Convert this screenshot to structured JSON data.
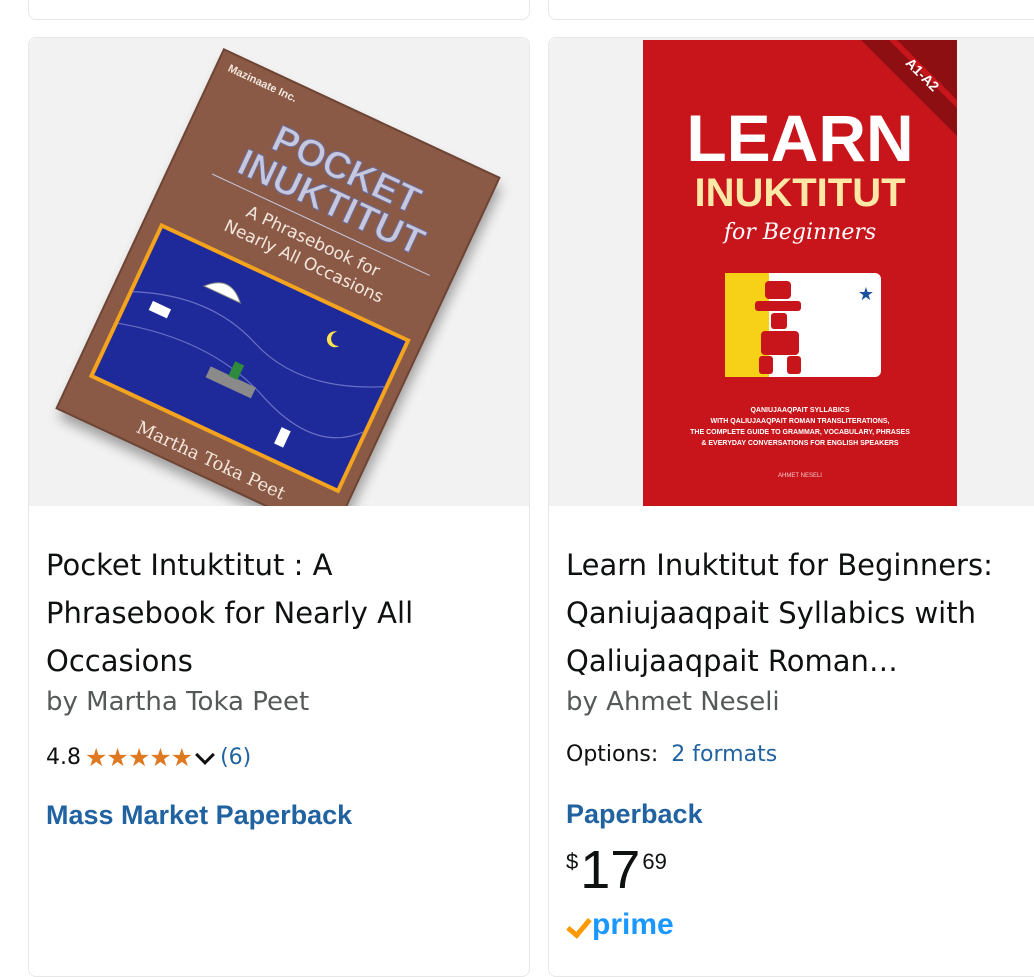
{
  "products": [
    {
      "cover": {
        "publisher": "Mazinaate Inc.",
        "title_line1": "POCKET",
        "title_line2": "INUKTITUT",
        "subtitle_line1": "A Phrasebook for",
        "subtitle_line2": "Nearly All Occasions",
        "author": "Martha Toka Peet"
      },
      "title_line1": "Pocket Intuktitut : A",
      "title_line2": "Phrasebook for Nearly All",
      "title_line3": "Occasions",
      "author": "by Martha Toka Peet",
      "rating": "4.8",
      "rating_stars": 4.8,
      "review_count": "(6)",
      "format": "Mass Market Paperback"
    },
    {
      "cover": {
        "level_badge": "A1-A2",
        "title_line1": "LEARN",
        "title_line2": "INUKTITUT",
        "title_line3": "for Beginners",
        "desc_line1": "QANIUJAAQPAIT SYLLABICS",
        "desc_line2": "WITH QALIUJAAQPAIT ROMAN TRANSLITERATIONS,",
        "desc_line3": "THE COMPLETE GUIDE TO GRAMMAR, VOCABULARY, PHRASES",
        "desc_line4": "& EVERYDAY CONVERSATIONS FOR ENGLISH SPEAKERS",
        "author": "AHMET NESELI"
      },
      "title_line1": "Learn Inuktitut for Beginners:",
      "title_line2": "Qaniujaaqpait Syllabics with",
      "title_line3": "Qaliujaaqpait Roman…",
      "author": "by Ahmet Neseli",
      "options_label": "Options:",
      "options_link": "2 formats",
      "format": "Paperback",
      "price_symbol": "$",
      "price_whole": "17",
      "price_fraction": "69",
      "prime_label": "prime"
    }
  ],
  "colors": {
    "link": "#2162a1",
    "star": "#de7921",
    "prime_check": "#ff9900",
    "prime_text": "#1a98ff"
  }
}
